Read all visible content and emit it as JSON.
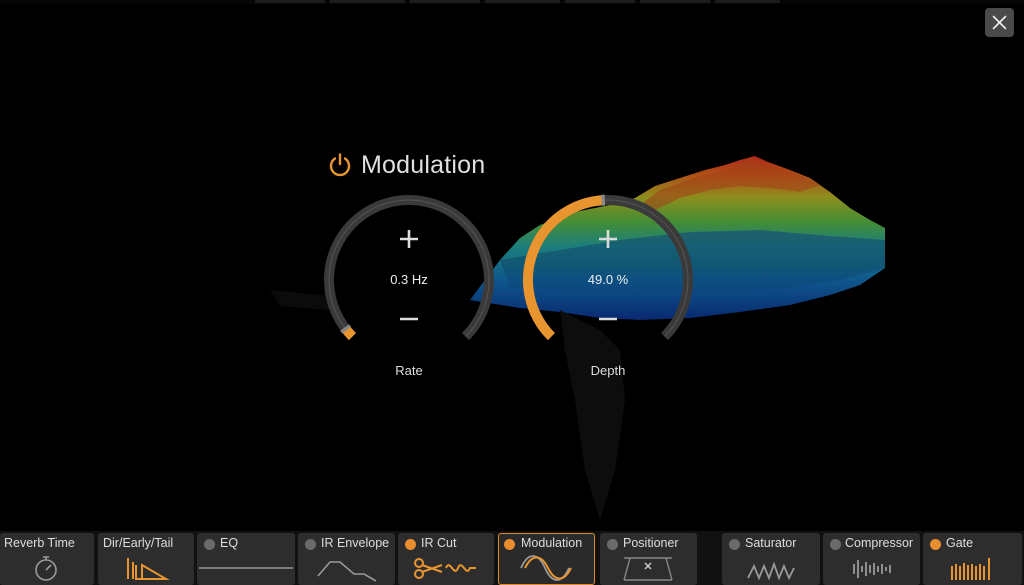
{
  "colors": {
    "accent": "#e8952f",
    "knob_track": "#3a3a3a",
    "tab_bg": "#2d2d2d",
    "inactive_dot": "#6a6a6a"
  },
  "dialog": {
    "close_icon": "close-icon"
  },
  "module": {
    "title": "Modulation",
    "power_on": true,
    "power_icon": "power-icon"
  },
  "knobs": [
    {
      "id": "rate",
      "label": "Rate",
      "value_text": "0.3 Hz",
      "fraction": 0.03,
      "increase_icon": "plus-icon",
      "decrease_icon": "minus-icon"
    },
    {
      "id": "depth",
      "label": "Depth",
      "value_text": "49.0 %",
      "fraction": 0.49,
      "increase_icon": "plus-icon",
      "decrease_icon": "minus-icon"
    }
  ],
  "tabs": [
    {
      "label": "Reverb Time",
      "has_dot": false,
      "enabled": false,
      "active": false,
      "icon": "stopwatch-icon"
    },
    {
      "label": "Dir/Early/Tail",
      "has_dot": false,
      "enabled": false,
      "active": false,
      "icon": "dir-early-tail-icon"
    },
    {
      "label": "EQ",
      "has_dot": true,
      "enabled": false,
      "active": false,
      "icon": "eq-curve-icon"
    },
    {
      "label": "IR Envelope",
      "has_dot": true,
      "enabled": false,
      "active": false,
      "icon": "envelope-icon"
    },
    {
      "label": "IR Cut",
      "has_dot": true,
      "enabled": true,
      "active": false,
      "icon": "scissors-icon"
    },
    {
      "label": "Modulation",
      "has_dot": true,
      "enabled": true,
      "active": true,
      "icon": "sine-wave-icon"
    },
    {
      "label": "Positioner",
      "has_dot": true,
      "enabled": false,
      "active": false,
      "icon": "positioner-icon"
    },
    {
      "label": "Saturator",
      "has_dot": true,
      "enabled": false,
      "active": false,
      "icon": "saturator-wave-icon"
    },
    {
      "label": "Compressor",
      "has_dot": true,
      "enabled": false,
      "active": false,
      "icon": "compressor-icon"
    },
    {
      "label": "Gate",
      "has_dot": true,
      "enabled": true,
      "active": false,
      "icon": "gate-icon"
    }
  ]
}
